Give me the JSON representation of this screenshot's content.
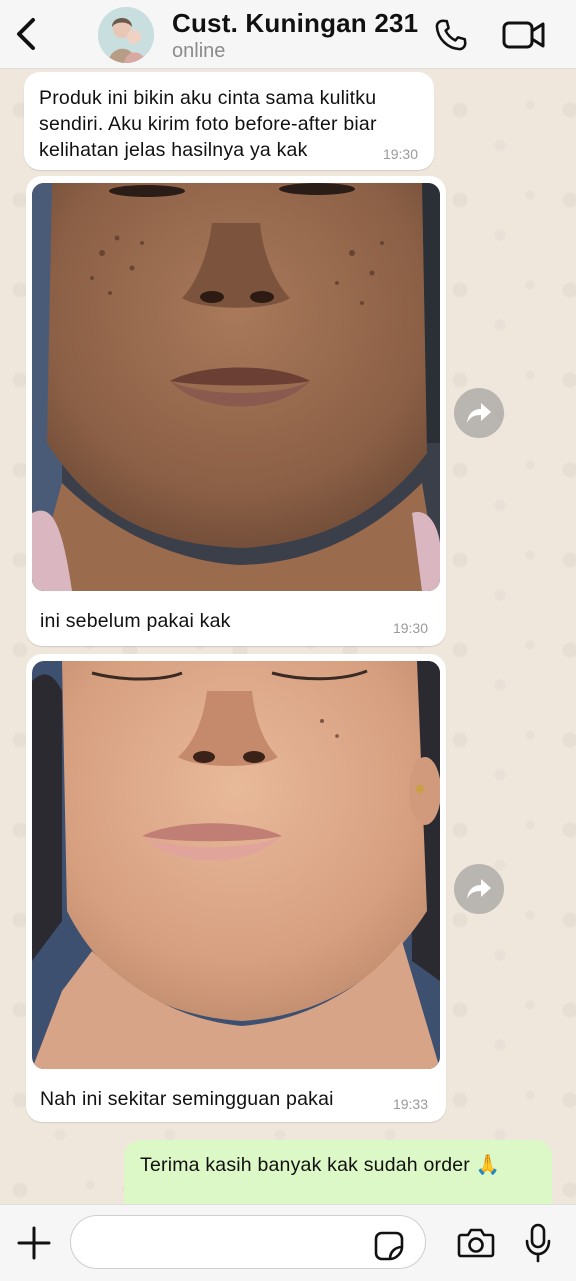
{
  "header": {
    "contact_name": "Cust. Kuningan 231",
    "status": "online"
  },
  "messages": [
    {
      "text": "Produk ini bikin aku cinta sama kulitku sendiri. Aku kirim foto before-after biar kelihatan jelas hasilnya ya kak",
      "time": "19:30"
    },
    {
      "caption": "ini sebelum pakai kak",
      "time": "19:30"
    },
    {
      "caption": "Nah ini sekitar semingguan pakai",
      "time": "19:33"
    },
    {
      "text": "Terima kasih banyak kak sudah order 🙏"
    }
  ],
  "input": {
    "value": ""
  },
  "icons": {
    "back": "chevron-left-icon",
    "call": "phone-icon",
    "video": "video-camera-icon",
    "forward": "forward-arrow-icon",
    "plus": "plus-icon",
    "sticker": "sticker-icon",
    "camera": "camera-icon",
    "mic": "microphone-icon"
  },
  "colors": {
    "chat_background": "#efe6dc",
    "incoming_bubble": "#ffffff",
    "outgoing_bubble": "#dcf8c6",
    "header_background": "#f6f6f6"
  }
}
